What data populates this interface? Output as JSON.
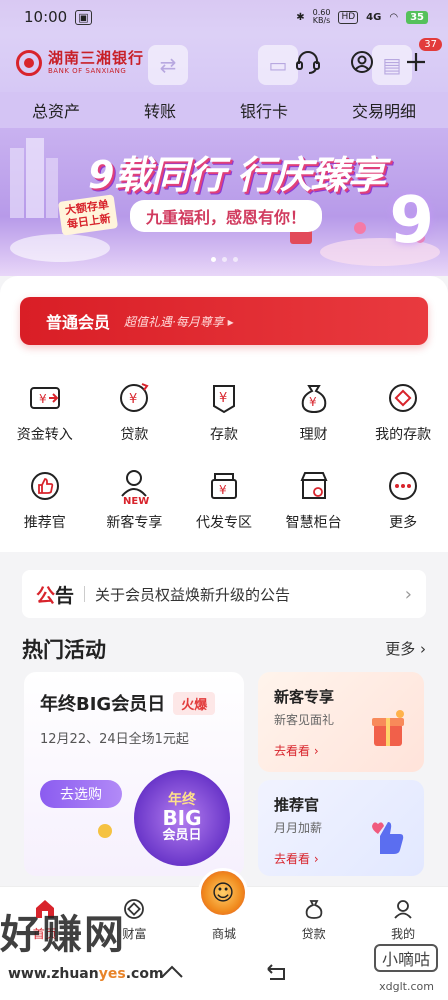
{
  "status_bar": {
    "time": "10:00",
    "network": "0.60\nKB/s",
    "hd": "HD",
    "signal": "4G",
    "battery": "35"
  },
  "header": {
    "logo_cn": "湖南三湘银行",
    "logo_en": "BANK OF SANXIANG",
    "message_badge": "37",
    "icons": [
      "headset-icon",
      "user-icon",
      "plus-icon"
    ]
  },
  "quick_tabs": [
    "总资产",
    "转账",
    "银行卡",
    "交易明细"
  ],
  "banner": {
    "title": "9载同行 行庆臻享",
    "subtitle": "九重福利，感恩有你！",
    "tag": "大额存单\n每日上新",
    "number": "9"
  },
  "member": {
    "title": "普通会员",
    "subtitle": "超值礼遇·每月尊享 ▸"
  },
  "grid_row1": [
    {
      "label": "资金转入",
      "icon": "transfer-in-icon"
    },
    {
      "label": "贷款",
      "icon": "loan-icon"
    },
    {
      "label": "存款",
      "icon": "deposit-icon"
    },
    {
      "label": "理财",
      "icon": "wealth-icon"
    },
    {
      "label": "我的存款",
      "icon": "my-deposit-icon"
    }
  ],
  "grid_row2": [
    {
      "label": "推荐官",
      "icon": "thumbs-up-icon"
    },
    {
      "label": "新客专享",
      "icon": "new-user-icon",
      "badge": "NEW"
    },
    {
      "label": "代发专区",
      "icon": "payroll-icon"
    },
    {
      "label": "智慧柜台",
      "icon": "smart-counter-icon"
    },
    {
      "label": "更多",
      "icon": "more-icon"
    }
  ],
  "notice": {
    "tag_red": "公",
    "tag_rest": "告",
    "text": "关于会员权益焕新升级的公告"
  },
  "hot": {
    "title": "热门活动",
    "more": "更多",
    "big_card": {
      "title": "年终BIG会员日",
      "badge": "火爆",
      "subtitle": "12月22、24日全场1元起",
      "button": "去选购",
      "logo_l1": "年终",
      "logo_l2": "BIG",
      "logo_l3": "会员日"
    },
    "small_cards": [
      {
        "title": "新客专享",
        "subtitle": "新客见面礼",
        "link": "去看看 ›"
      },
      {
        "title": "推荐官",
        "subtitle": "月月加薪",
        "link": "去看看 ›"
      }
    ]
  },
  "bottom_nav": [
    {
      "label": "首页",
      "icon": "home-icon",
      "active": true
    },
    {
      "label": "财富",
      "icon": "wealth-nav-icon"
    },
    {
      "label": "商城",
      "icon": "mall-icon"
    },
    {
      "label": "贷款",
      "icon": "loan-nav-icon"
    },
    {
      "label": "我的",
      "icon": "profile-icon"
    }
  ],
  "watermark": {
    "text": "好赚网",
    "url_a": "www.zhuan",
    "url_hl": "yes",
    "url_b": ".com",
    "right": "小嘀咕",
    "right_url": "xdglt.com"
  },
  "colors": {
    "brand_red": "#d8242c",
    "banner_purple": "#b79ae9"
  }
}
